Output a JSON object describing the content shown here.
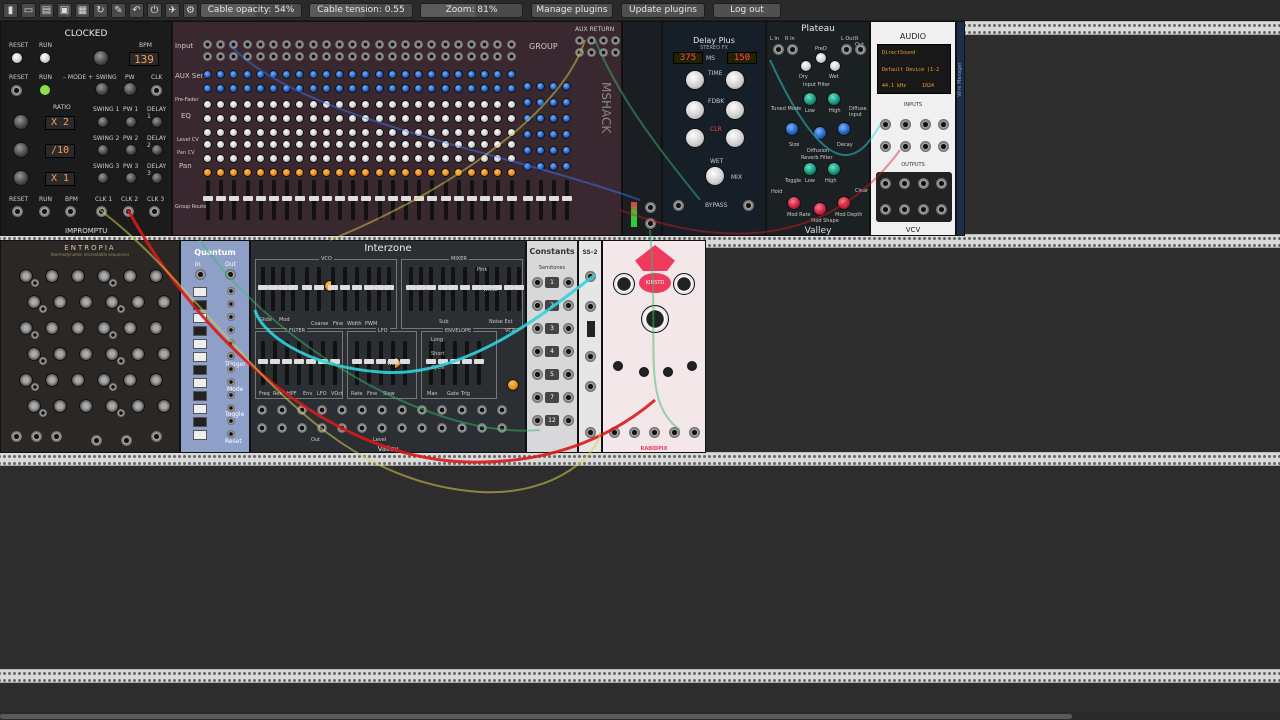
{
  "toolbar": {
    "icon_buttons": [
      "lock-icon",
      "new-file-icon",
      "open-icon",
      "save-icon",
      "save-as-icon",
      "revert-icon",
      "clear-icon",
      "undo-icon",
      "power-icon",
      "plugin-icon",
      "cpu-meter-icon",
      "rack-lock-icon"
    ],
    "cable_opacity": "Cable opacity: 54%",
    "cable_opacity_value": 0.54,
    "cable_tension": "Cable tension: 0.55",
    "cable_tension_value": 0.55,
    "zoom": "Zoom: 81%",
    "zoom_value": 0.81,
    "manage_plugins": "Manage plugins",
    "update_plugins": "Update plugins",
    "log_out": "Log out"
  },
  "modules": {
    "clocked": {
      "title": "CLOCKED",
      "labels": [
        "RESET",
        "RUN",
        "BPM",
        "RESET",
        "RUN",
        "– MODE +",
        "SWING",
        "PW",
        "CLK",
        "RATIO",
        "SWING 1",
        "PW 1",
        "DELAY 1",
        "SWING 2",
        "PW 2",
        "DELAY 2",
        "SWING 3",
        "PW 3",
        "DELAY 3",
        "RESET",
        "RUN",
        "BPM",
        "CLK 1",
        "CLK 2",
        "CLK 3"
      ],
      "bpm": "139",
      "ratios": [
        "X 2",
        "/10",
        "X 1"
      ],
      "brand": "IMPROMPTU"
    },
    "mixer": {
      "row_labels": [
        "Input",
        "AUX Send",
        "Pre-Fader",
        "EQ",
        "Level CV",
        "Pan CV",
        "Pan",
        "Group Route"
      ],
      "group_label": "GROUP",
      "aux_return_label": "AUX RETURN",
      "brand": "MSHACK"
    },
    "delay": {
      "title": "Delay Plus",
      "subtitle": "STEREO FX",
      "time_display": "375",
      "ms_label": "MS",
      "feedback_display": "150",
      "knob_labels": [
        "TIME",
        "FDBK",
        "CLR",
        "WET",
        "MIX"
      ],
      "bypass_label": "BYPASS"
    },
    "plateau": {
      "title": "Plateau",
      "labels": [
        "L In",
        "R In",
        "Dry",
        "Wet",
        "PreD",
        "L Out",
        "R Out",
        "Input Filter",
        "Low",
        "High",
        "Diffuse Input",
        "Tuned Mode",
        "Size",
        "Decay",
        "Diffusion",
        "Reverb Filter",
        "Low",
        "High",
        "Hold",
        "Toggle",
        "Clear",
        "Mod Rate",
        "Mod Shape",
        "Mod Depth"
      ],
      "brand": "Valley"
    },
    "audio": {
      "title": "AUDIO",
      "driver": "DirectSound",
      "device": "Default Device (1-2",
      "rate": "44.1 kHz",
      "block": "1024",
      "inputs_label": "INPUTS",
      "outputs_label": "OUTPUTS",
      "brand": "VCV",
      "side_label": "Wire Manager"
    },
    "entropia": {
      "title": "ENTROPIA",
      "subtitle": "thermodynamic microstable sequencer"
    },
    "quantum": {
      "title": "Quantum",
      "labels": [
        "In",
        "Out",
        "Trigger",
        "Mode",
        "Toggle",
        "Reset"
      ]
    },
    "interzone": {
      "title": "Interzone",
      "section_labels": [
        "VCO",
        "MIXER",
        "FILTER",
        "LFO",
        "ENVELOPE",
        "VCA"
      ],
      "labels": [
        "Glide",
        "Mod",
        "Coarse",
        "Fine",
        "Width",
        "PWM",
        "Pink",
        "White",
        "Sub",
        "Noise Ext",
        "Freq",
        "Res",
        "HPF",
        "Env",
        "LFO",
        "VOct",
        "Rate",
        "Fine",
        "Slew",
        "Wave",
        "Long",
        "Short",
        "Cycle",
        "Man",
        "Gate",
        "Trig",
        "Level",
        "Out"
      ],
      "brand": "Valley"
    },
    "constants": {
      "title": "Constants",
      "subtitle": "Semitones",
      "values": [
        "1",
        "2",
        "3",
        "4",
        "5",
        "7",
        "12"
      ]
    },
    "ss2": {
      "title": "SS-2"
    },
    "pink": {
      "badge": "KINSTD",
      "brand": "RABIDPIX"
    }
  },
  "colors": {
    "cable_cyan": "#2fd3dc",
    "cable_red": "#d81a1a",
    "cable_yellow": "#d8d04a",
    "cable_green": "#3ab86a",
    "cable_blue": "#3d7bff"
  }
}
